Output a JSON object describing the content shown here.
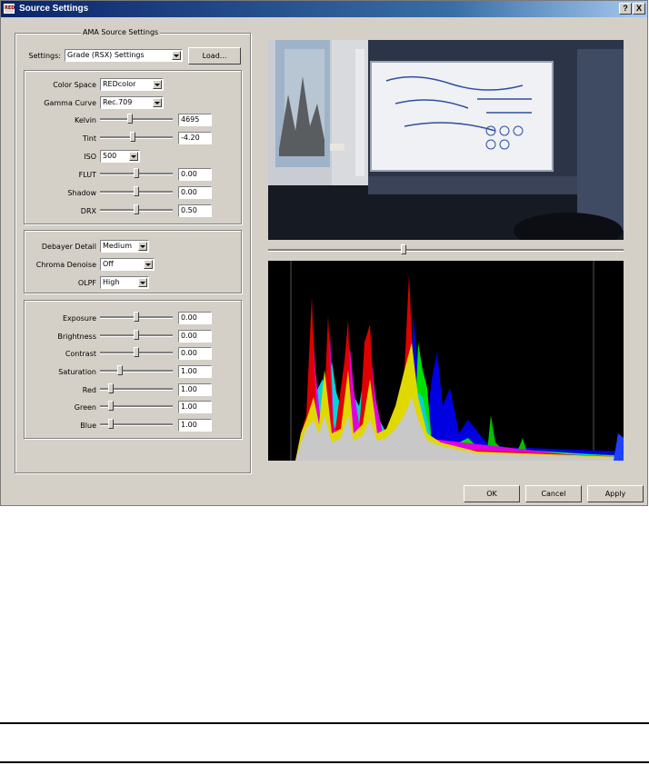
{
  "window": {
    "title": "Source Settings",
    "icon_text": "RED",
    "help_label": "?",
    "close_label": "X"
  },
  "group": {
    "legend": "AMA Source Settings"
  },
  "settings": {
    "label": "Settings:",
    "value": "Grade (RSX) Settings",
    "load_label": "Load..."
  },
  "color_space": {
    "label": "Color Space",
    "value": "REDcolor"
  },
  "gamma_curve": {
    "label": "Gamma Curve",
    "value": "Rec.709"
  },
  "kelvin": {
    "label": "Kelvin",
    "value": "4695",
    "level": 0.4
  },
  "tint": {
    "label": "Tint",
    "value": "-4.20",
    "level": 0.45
  },
  "iso": {
    "label": "ISO",
    "value": "500"
  },
  "flut": {
    "label": "FLUT",
    "value": "0.00",
    "level": 0.5
  },
  "shadow": {
    "label": "Shadow",
    "value": "0.00",
    "level": 0.5
  },
  "drx": {
    "label": "DRX",
    "value": "0.50",
    "level": 0.5
  },
  "debayer_detail": {
    "label": "Debayer Detail",
    "value": "Medium"
  },
  "chroma_denoise": {
    "label": "Chroma Denoise",
    "value": "Off"
  },
  "olpf": {
    "label": "OLPF",
    "value": "High"
  },
  "exposure": {
    "label": "Exposure",
    "value": "0.00",
    "level": 0.5
  },
  "brightness": {
    "label": "Brightness",
    "value": "0.00",
    "level": 0.5
  },
  "contrast": {
    "label": "Contrast",
    "value": "0.00",
    "level": 0.5
  },
  "saturation": {
    "label": "Saturation",
    "value": "1.00",
    "level": 0.25
  },
  "red": {
    "label": "Red",
    "value": "1.00",
    "level": 0.12
  },
  "green": {
    "label": "Green",
    "value": "1.00",
    "level": 0.12
  },
  "blue": {
    "label": "Blue",
    "value": "1.00",
    "level": 0.12
  },
  "timeline": {
    "level": 0.38
  },
  "buttons": {
    "ok": "OK",
    "cancel": "Cancel",
    "apply": "Apply"
  }
}
